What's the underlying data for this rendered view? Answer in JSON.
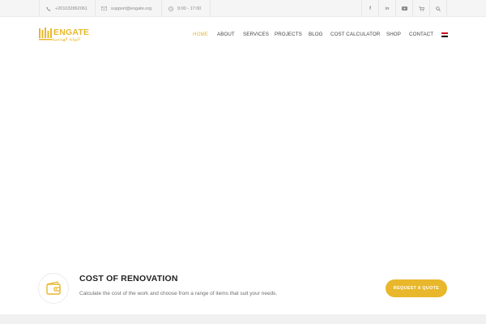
{
  "topbar": {
    "phone": "+201032862061",
    "email": "support@engate.org",
    "hours": "9:00 - 17:00",
    "phone_icon": "phone-icon",
    "email_icon": "envelope-icon",
    "hours_icon": "clock-icon",
    "social": [
      {
        "icon": "facebook-icon",
        "glyph": "f"
      },
      {
        "icon": "linkedin-icon",
        "glyph": "in"
      },
      {
        "icon": "youtube-icon",
        "glyph": "▶"
      },
      {
        "icon": "cart-icon",
        "glyph": "🛒"
      },
      {
        "icon": "search-icon",
        "glyph": "⚲"
      }
    ]
  },
  "header": {
    "logo_text": "ENGATE",
    "logo_subtext": "البوابة الهندسية",
    "nav": [
      {
        "label": "HOME",
        "active": true
      },
      {
        "label": "ABOUT",
        "active": false
      },
      {
        "label": "SERVICES",
        "active": false
      },
      {
        "label": "PROJECTS",
        "active": false
      },
      {
        "label": "BLOG",
        "active": false
      },
      {
        "label": "COST CALCULATOR",
        "active": false
      },
      {
        "label": "SHOP",
        "active": false
      },
      {
        "label": "CONTACT",
        "active": false
      }
    ],
    "language_icon": "egypt-flag-icon"
  },
  "cta": {
    "title": "COST OF RENOVATION",
    "text": "Calculate the cost of the work and choose from a range of items that suit your needs.",
    "button": "REQUEST A QUOTE",
    "icon": "wallet-icon"
  },
  "colors": {
    "accent": "#e8b72b",
    "text_dark": "#222222",
    "text_muted": "#6f6f6f",
    "topbar_bg": "#f5f5f5"
  }
}
